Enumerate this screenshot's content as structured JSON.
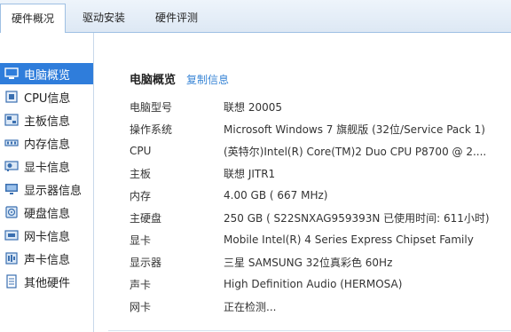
{
  "tabs": [
    {
      "label": "硬件概况"
    },
    {
      "label": "驱动安装"
    },
    {
      "label": "硬件评测"
    }
  ],
  "sidebar": {
    "items": [
      {
        "label": "电脑概览",
        "icon": "computer-icon"
      },
      {
        "label": "CPU信息",
        "icon": "cpu-icon"
      },
      {
        "label": "主板信息",
        "icon": "motherboard-icon"
      },
      {
        "label": "内存信息",
        "icon": "memory-icon"
      },
      {
        "label": "显卡信息",
        "icon": "graphics-card-icon"
      },
      {
        "label": "显示器信息",
        "icon": "monitor-icon"
      },
      {
        "label": "硬盘信息",
        "icon": "disk-icon"
      },
      {
        "label": "网卡信息",
        "icon": "network-card-icon"
      },
      {
        "label": "声卡信息",
        "icon": "sound-card-icon"
      },
      {
        "label": "其他硬件",
        "icon": "other-hardware-icon"
      }
    ]
  },
  "main": {
    "title": "电脑概览",
    "copy_link": "复制信息",
    "rows": [
      {
        "label": "电脑型号",
        "value": "联想 20005"
      },
      {
        "label": "操作系统",
        "value": "Microsoft Windows 7 旗舰版  (32位/Service Pack 1)"
      },
      {
        "label": "CPU",
        "value": "(英特尔)Intel(R) Core(TM)2 Duo CPU     P8700  @ 2...."
      },
      {
        "label": "主板",
        "value": "联想 JITR1"
      },
      {
        "label": "内存",
        "value": "4.00 GB (   667 MHz)"
      },
      {
        "label": "主硬盘",
        "value": "250 GB (   S22SNXAG959393N 已使用时间: 611小时)"
      },
      {
        "label": "显卡",
        "value": "Mobile Intel(R) 4 Series Express Chipset Family"
      },
      {
        "label": "显示器",
        "value": "三星 SAMSUNG 32位真彩色 60Hz"
      },
      {
        "label": "声卡",
        "value": "High Definition Audio (HERMOSA)"
      },
      {
        "label": "网卡",
        "value": "正在检测..."
      }
    ]
  },
  "colors": {
    "accent": "#2f7ddb",
    "link": "#3a86d6"
  }
}
